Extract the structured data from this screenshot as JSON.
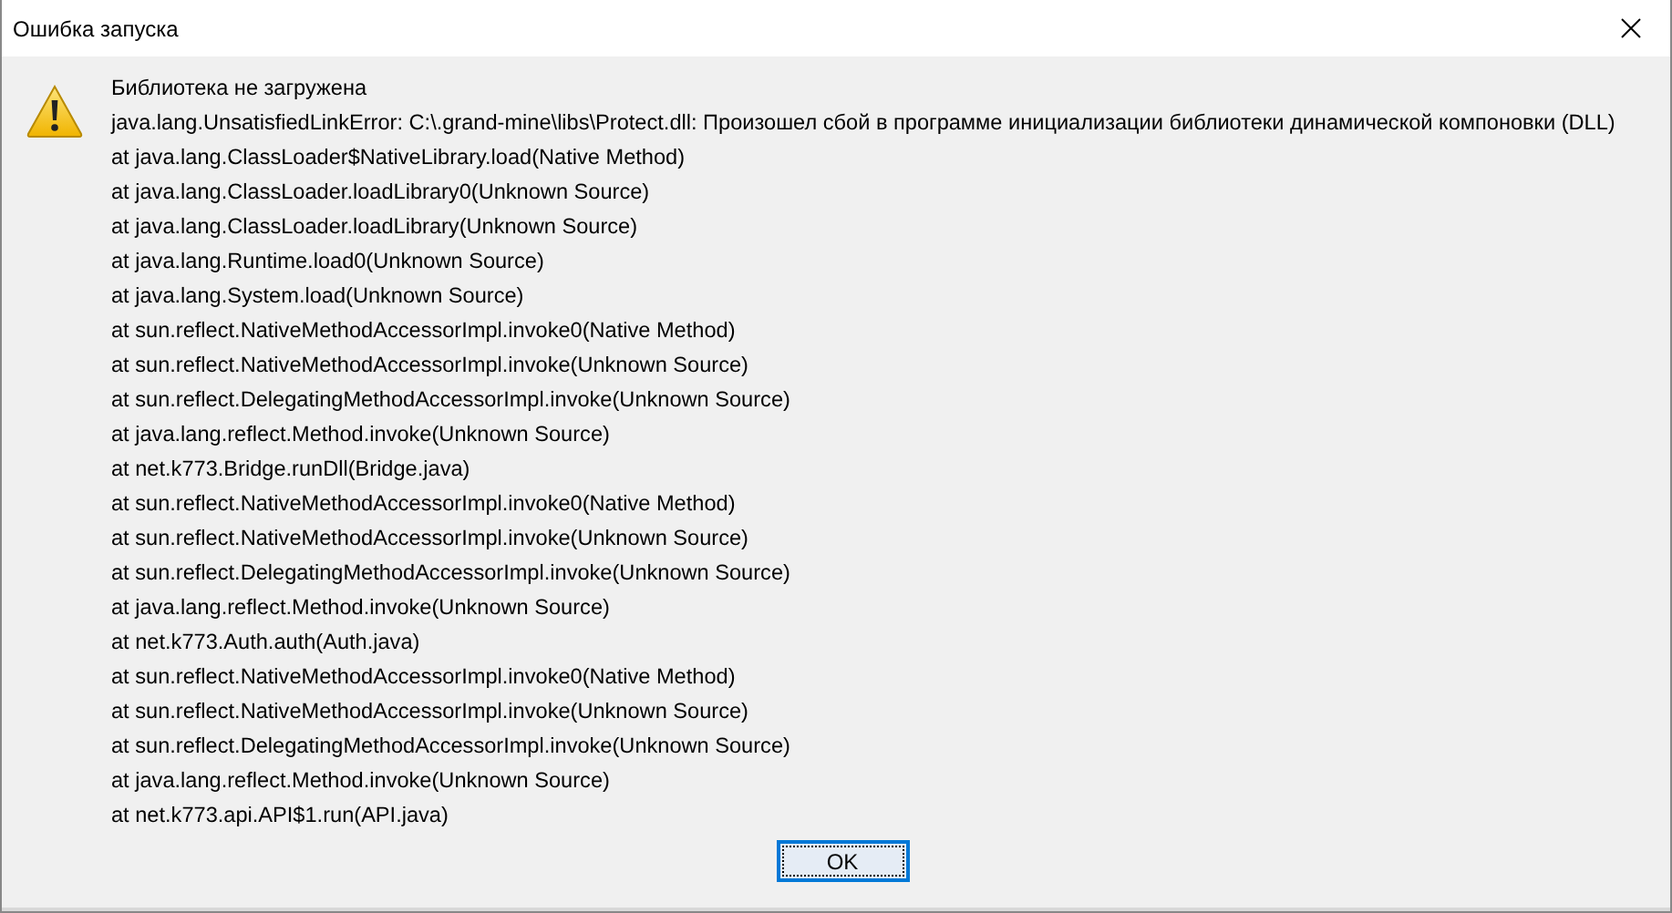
{
  "window": {
    "title": "Ошибка запуска"
  },
  "message": {
    "heading": "Библиотека не загружена",
    "lines": [
      "java.lang.UnsatisfiedLinkError: C:\\.grand-mine\\libs\\Protect.dll: Произошел сбой в программе инициализации библиотеки динамической компоновки (DLL)",
      "at java.lang.ClassLoader$NativeLibrary.load(Native Method)",
      "at java.lang.ClassLoader.loadLibrary0(Unknown Source)",
      "at java.lang.ClassLoader.loadLibrary(Unknown Source)",
      "at java.lang.Runtime.load0(Unknown Source)",
      "at java.lang.System.load(Unknown Source)",
      "at sun.reflect.NativeMethodAccessorImpl.invoke0(Native Method)",
      "at sun.reflect.NativeMethodAccessorImpl.invoke(Unknown Source)",
      "at sun.reflect.DelegatingMethodAccessorImpl.invoke(Unknown Source)",
      "at java.lang.reflect.Method.invoke(Unknown Source)",
      "at net.k773.Bridge.runDll(Bridge.java)",
      "at sun.reflect.NativeMethodAccessorImpl.invoke0(Native Method)",
      "at sun.reflect.NativeMethodAccessorImpl.invoke(Unknown Source)",
      "at sun.reflect.DelegatingMethodAccessorImpl.invoke(Unknown Source)",
      "at java.lang.reflect.Method.invoke(Unknown Source)",
      "at net.k773.Auth.auth(Auth.java)",
      "at sun.reflect.NativeMethodAccessorImpl.invoke0(Native Method)",
      "at sun.reflect.NativeMethodAccessorImpl.invoke(Unknown Source)",
      "at sun.reflect.DelegatingMethodAccessorImpl.invoke(Unknown Source)",
      "at java.lang.reflect.Method.invoke(Unknown Source)",
      "at net.k773.api.API$1.run(API.java)"
    ]
  },
  "buttons": [
    {
      "label": "OK",
      "focused": true
    }
  ]
}
